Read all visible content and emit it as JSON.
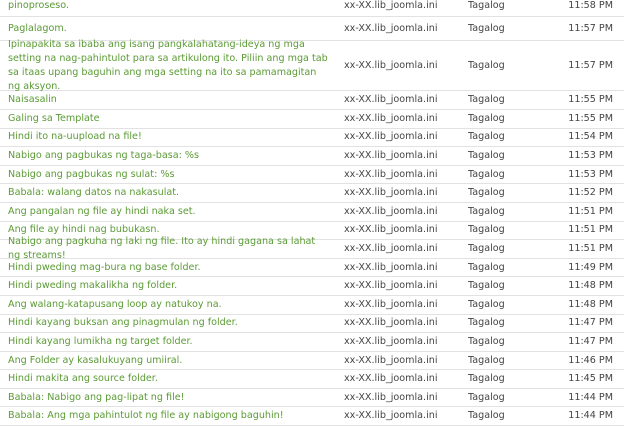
{
  "rows": [
    {
      "text": "pinoproseso.",
      "file": "xx-XX.lib_joomla.ini",
      "language": "Tagalog",
      "time": "11:58 PM"
    },
    {
      "text": "Paglalagom.",
      "file": "xx-XX.lib_joomla.ini",
      "language": "Tagalog",
      "time": "11:57 PM"
    },
    {
      "text": "Ipinapakita sa ibaba ang isang pangkalahatang-ideya ng mga setting na nag-pahintulot para sa artikulong ito. Piliin ang mga tab sa itaas upang baguhin ang mga setting na ito sa pamamagitan ng aksyon.",
      "file": "xx-XX.lib_joomla.ini",
      "language": "Tagalog",
      "time": "11:57 PM"
    },
    {
      "text": "Naisasalin",
      "file": "xx-XX.lib_joomla.ini",
      "language": "Tagalog",
      "time": "11:55 PM"
    },
    {
      "text": "Galing sa Template",
      "file": "xx-XX.lib_joomla.ini",
      "language": "Tagalog",
      "time": "11:55 PM"
    },
    {
      "text": "Hindi ito na-uupload na file!",
      "file": "xx-XX.lib_joomla.ini",
      "language": "Tagalog",
      "time": "11:54 PM"
    },
    {
      "text": "Nabigo ang pagbukas ng taga-basa: %s",
      "file": "xx-XX.lib_joomla.ini",
      "language": "Tagalog",
      "time": "11:53 PM"
    },
    {
      "text": "Nabigo ang pagbukas ng sulat: %s",
      "file": "xx-XX.lib_joomla.ini",
      "language": "Tagalog",
      "time": "11:53 PM"
    },
    {
      "text": "Babala: walang datos na nakasulat.",
      "file": "xx-XX.lib_joomla.ini",
      "language": "Tagalog",
      "time": "11:52 PM"
    },
    {
      "text": "Ang pangalan ng file ay hindi naka set.",
      "file": "xx-XX.lib_joomla.ini",
      "language": "Tagalog",
      "time": "11:51 PM"
    },
    {
      "text": "Ang file ay hindi nag bubukasn.",
      "file": "xx-XX.lib_joomla.ini",
      "language": "Tagalog",
      "time": "11:51 PM"
    },
    {
      "text": "Nabigo ang pagkuha ng laki ng file. Ito ay hindi gagana sa lahat ng streams!",
      "file": "xx-XX.lib_joomla.ini",
      "language": "Tagalog",
      "time": "11:51 PM"
    },
    {
      "text": "Hindi pweding mag-bura ng base folder.",
      "file": "xx-XX.lib_joomla.ini",
      "language": "Tagalog",
      "time": "11:49 PM"
    },
    {
      "text": "Hindi pweding makalikha ng folder.",
      "file": "xx-XX.lib_joomla.ini",
      "language": "Tagalog",
      "time": "11:48 PM"
    },
    {
      "text": "Ang walang-katapusang loop ay natukoy na.",
      "file": "xx-XX.lib_joomla.ini",
      "language": "Tagalog",
      "time": "11:48 PM"
    },
    {
      "text": "Hindi kayang buksan ang pinagmulan ng folder.",
      "file": "xx-XX.lib_joomla.ini",
      "language": "Tagalog",
      "time": "11:47 PM"
    },
    {
      "text": "Hindi kayang lumikha ng target folder.",
      "file": "xx-XX.lib_joomla.ini",
      "language": "Tagalog",
      "time": "11:47 PM"
    },
    {
      "text": "Ang Folder ay kasalukuyang umiiral.",
      "file": "xx-XX.lib_joomla.ini",
      "language": "Tagalog",
      "time": "11:46 PM"
    },
    {
      "text": "Hindi makita ang source folder.",
      "file": "xx-XX.lib_joomla.ini",
      "language": "Tagalog",
      "time": "11:45 PM"
    },
    {
      "text": "Babala: Nabigo ang pag-lipat ng file!",
      "file": "xx-XX.lib_joomla.ini",
      "language": "Tagalog",
      "time": "11:44 PM"
    },
    {
      "text": "Babala: Ang mga pahintulot ng file ay nabigong baguhin!",
      "file": "xx-XX.lib_joomla.ini",
      "language": "Tagalog",
      "time": "11:44 PM"
    }
  ]
}
